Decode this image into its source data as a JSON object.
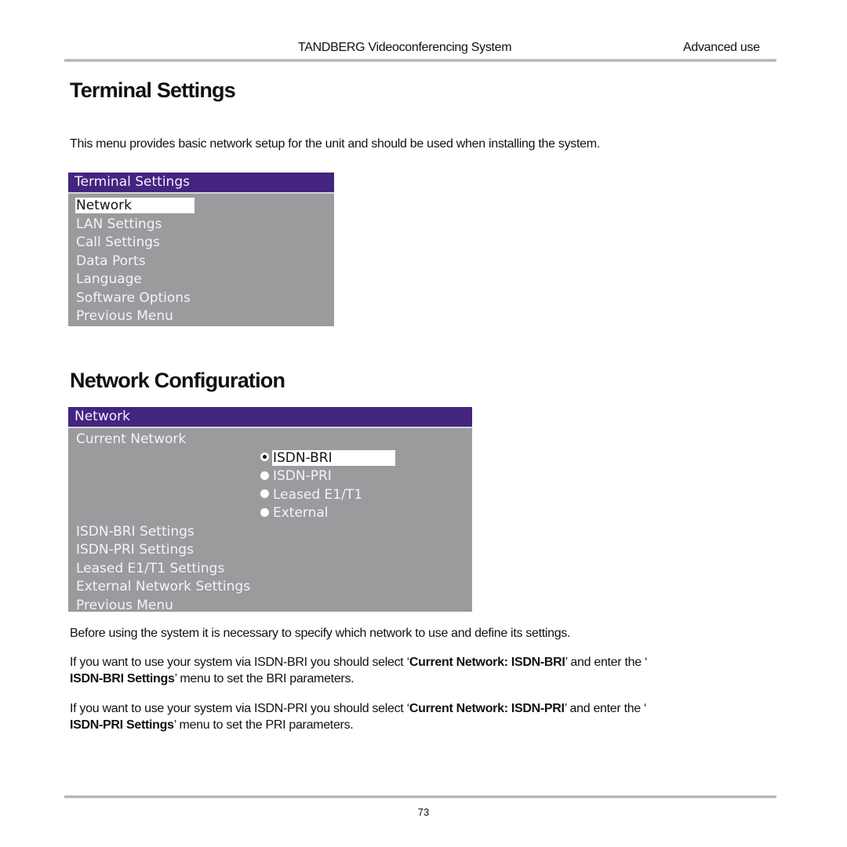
{
  "header": {
    "title": "TANDBERG Videoconferencing System",
    "section": "Advanced use"
  },
  "section1": {
    "heading": "Terminal Settings",
    "intro": "This menu provides basic network setup for the unit and should be used when installing the system.",
    "menu": {
      "title": "Terminal Settings",
      "items": [
        {
          "label": "Network",
          "selected": true
        },
        {
          "label": "LAN Settings"
        },
        {
          "label": "Call Settings"
        },
        {
          "label": "Data Ports"
        },
        {
          "label": "Language"
        },
        {
          "label": "Software Options"
        },
        {
          "label": "Previous Menu"
        }
      ]
    }
  },
  "section2": {
    "heading": "Network Configuration",
    "menu": {
      "title": "Network",
      "current_label": "Current Network",
      "options": [
        {
          "label": "ISDN-BRI",
          "checked": true
        },
        {
          "label": "ISDN-PRI"
        },
        {
          "label": "Leased E1/T1"
        },
        {
          "label": "External"
        }
      ],
      "items": [
        {
          "label": "ISDN-BRI Settings"
        },
        {
          "label": "ISDN-PRI Settings"
        },
        {
          "label": "Leased E1/T1 Settings"
        },
        {
          "label": "External Network Settings"
        },
        {
          "label": "Previous Menu"
        }
      ]
    },
    "para1": "Before using the system it is necessary to specify which network to use and define its settings.",
    "para2": {
      "a": "If you want to use your system via ISDN-BRI you should select ‘",
      "b": "Current Network: ISDN-BRI",
      "c": "’ and enter the ‘",
      "d": "ISDN-BRI Settings",
      "e": "’ menu to set the BRI parameters."
    },
    "para3": {
      "a": "If you want to use your system via ISDN-PRI  you should select ‘",
      "b": "Current Network: ISDN-PRI",
      "c": "’ and enter the ‘",
      "d": "ISDN-PRI Settings",
      "e": "’ menu to set the PRI parameters."
    }
  },
  "footer": {
    "page_number": "73"
  },
  "colors": {
    "menu_title_bg": "#43247f",
    "menu_bg": "#9a9b9c",
    "menu_text": "#f7f1ff"
  }
}
